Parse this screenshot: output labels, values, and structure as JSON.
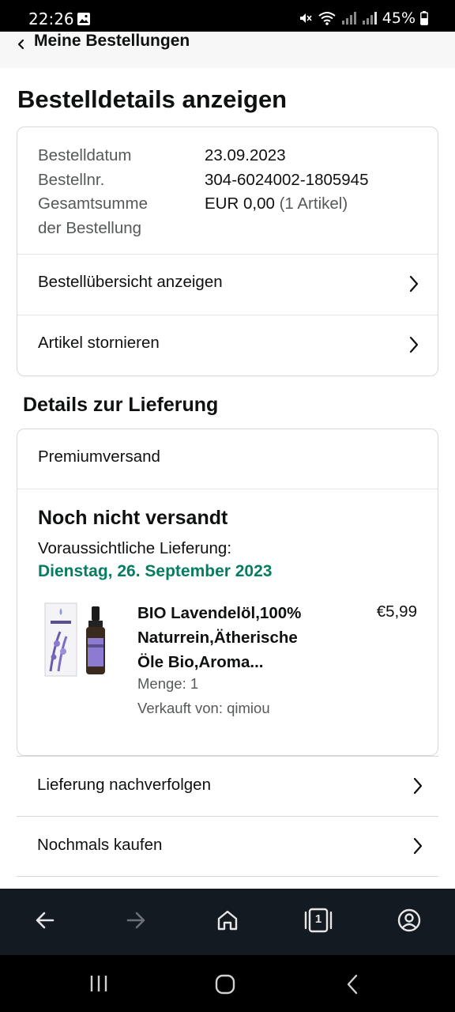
{
  "status_bar": {
    "time": "22:26",
    "battery": "45%"
  },
  "nav": {
    "back_label": "Meine Bestellungen"
  },
  "page_title": "Bestelldetails anzeigen",
  "order_summary": {
    "date_label": "Bestelldatum",
    "date_value": "23.09.2023",
    "number_label": "Bestellnr.",
    "number_value": "304-6024002-1805945",
    "total_label_1": "Gesamtsumme",
    "total_label_2": "der Bestellung",
    "total_value": "EUR 0,00",
    "total_items": "(1 Artikel)"
  },
  "summary_links": {
    "overview": "Bestellübersicht anzeigen",
    "cancel": "Artikel stornieren"
  },
  "delivery": {
    "section_title": "Details zur Lieferung",
    "shipping_method": "Premiumversand",
    "status": "Noch nicht versandt",
    "eta_label": "Voraussichtliche Lieferung:",
    "eta_date": "Dienstag, 26. September 2023",
    "accent_color": "#067d62"
  },
  "product": {
    "title_line1": "BIO Lavendelöl,100%",
    "title_line2": "Naturrein,Ätherische",
    "title_line3": "Öle Bio,Aroma...",
    "price": "€5,99",
    "quantity": "Menge: 1",
    "seller": "Verkauft von: qimiou",
    "image_icon": "lavender-oil-bottle"
  },
  "actions": {
    "track": "Lieferung nachverfolgen",
    "buy_again": "Nochmals kaufen"
  },
  "browser_bar": {
    "tab_count": "1"
  }
}
